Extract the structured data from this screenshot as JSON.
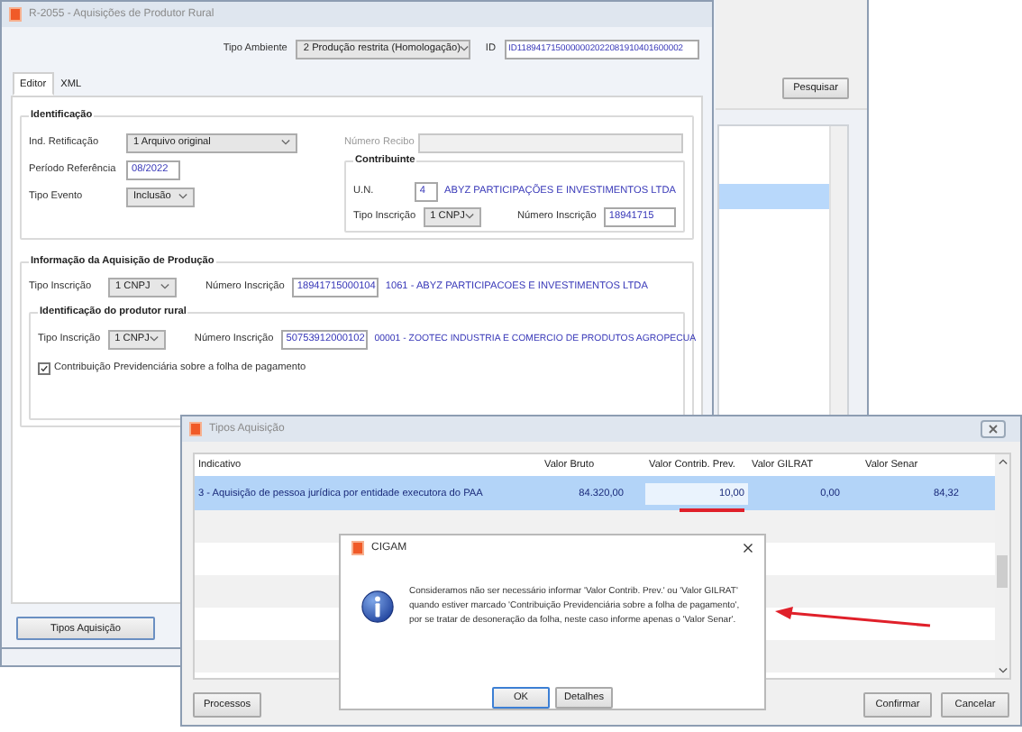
{
  "background_window": {
    "search_button": "Pesquisar",
    "list_rows": [
      {
        "selected": true
      }
    ]
  },
  "main_window": {
    "title": "R-2055 - Aquisições de Produtor Rural",
    "environment": {
      "label": "Tipo Ambiente",
      "value": "2 Produção restrita (Homologação)"
    },
    "id": {
      "label": "ID",
      "value": "ID1189417150000002022081910401600002"
    },
    "tabs": [
      {
        "label": "Editor",
        "selected": true
      },
      {
        "label": "XML",
        "selected": false
      }
    ],
    "identificacao": {
      "title": "Identificação",
      "retificacao": {
        "label": "Ind. Retificação",
        "value": "1 Arquivo original"
      },
      "recibo": {
        "label": "Número Recibo",
        "disabled": true
      },
      "periodo": {
        "label": "Período Referência",
        "value": "08/2022"
      },
      "tipo_evento": {
        "label": "Tipo Evento",
        "value": "Inclusão"
      },
      "contribuinte": {
        "title": "Contribuinte",
        "un": {
          "label": "U.N.",
          "value": "4",
          "description": "ABYZ PARTICIPAÇÕES E INVESTIMENTOS LTDA"
        },
        "tipo_inscricao": {
          "label": "Tipo Inscrição",
          "value": "1 CNPJ"
        },
        "numero_inscricao": {
          "label": "Número Inscrição",
          "value": "18941715"
        }
      }
    },
    "aquisicao": {
      "title": "Informação da Aquisição de Produção",
      "tipo_inscricao": {
        "label": "Tipo Inscrição",
        "value": "1 CNPJ"
      },
      "numero_inscricao": {
        "label": "Número Inscrição",
        "value": "18941715000104",
        "description": "1061 - ABYZ PARTICIPACOES E INVESTIMENTOS LTDA"
      },
      "produtor": {
        "title": "Identificação do produtor rural",
        "tipo_inscricao": {
          "label": "Tipo Inscrição",
          "value": "1 CNPJ"
        },
        "numero_inscricao": {
          "label": "Número Inscrição",
          "value": "50753912000102",
          "description": "00001 - ZOOTEC INDUSTRIA E COMERCIO DE PRODUTOS AGROPECUA"
        },
        "checkbox": {
          "label": "Contribuição Previdenciária sobre a folha de pagamento",
          "checked": true
        }
      }
    },
    "tipos_button": "Tipos Aquisição"
  },
  "tipos_window": {
    "title": "Tipos Aquisição",
    "columns": [
      "Indicativo",
      "Valor Bruto",
      "Valor Contrib. Prev.",
      "Valor GILRAT",
      "Valor Senar"
    ],
    "rows": [
      {
        "cells": [
          "3 - Aquisição de pessoa jurídica por entidade executora do PAA",
          "84.320,00",
          "10,00",
          "0,00",
          "84,32"
        ],
        "selected": true
      }
    ],
    "left_buttons": [
      "Processos"
    ],
    "right_buttons": [
      "Confirmar",
      "Cancelar"
    ]
  },
  "dialog": {
    "title": "CIGAM",
    "message": "Consideramos não ser necessário informar 'Valor Contrib. Prev.' ou 'Valor GILRAT' quando estiver marcado 'Contribuição Previdenciária sobre a folha de pagamento', por se tratar de desoneração da folha, neste caso informe apenas o 'Valor Senar'.",
    "buttons": [
      "OK",
      "Detalhes"
    ]
  }
}
